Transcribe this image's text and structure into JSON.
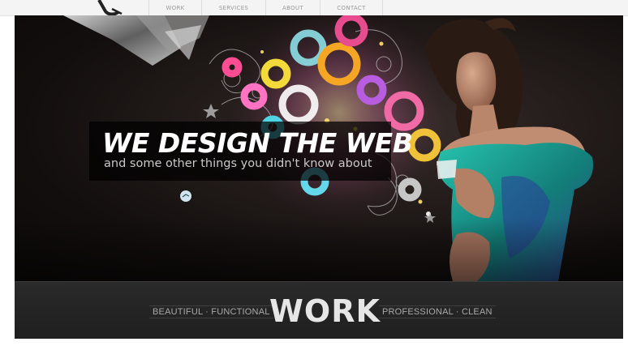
{
  "nav": {
    "items": [
      {
        "label": "WORK"
      },
      {
        "label": "SERVICES"
      },
      {
        "label": "ABOUT"
      },
      {
        "label": "CONTACT"
      }
    ]
  },
  "hero": {
    "headline": "WE DESIGN THE WEB",
    "subline": "and some other things you didn't know about"
  },
  "footer_band": {
    "left_text": "BEAUTIFUL · FUNCTIONAL",
    "title": "WORK",
    "right_text": "PROFESSIONAL · CLEAN"
  },
  "colors": {
    "hero_background": "#1a1413",
    "dress": "#1aa394",
    "accent_pink": "#e8338a",
    "accent_yellow": "#f6d33b",
    "bar_background": "#252525"
  }
}
